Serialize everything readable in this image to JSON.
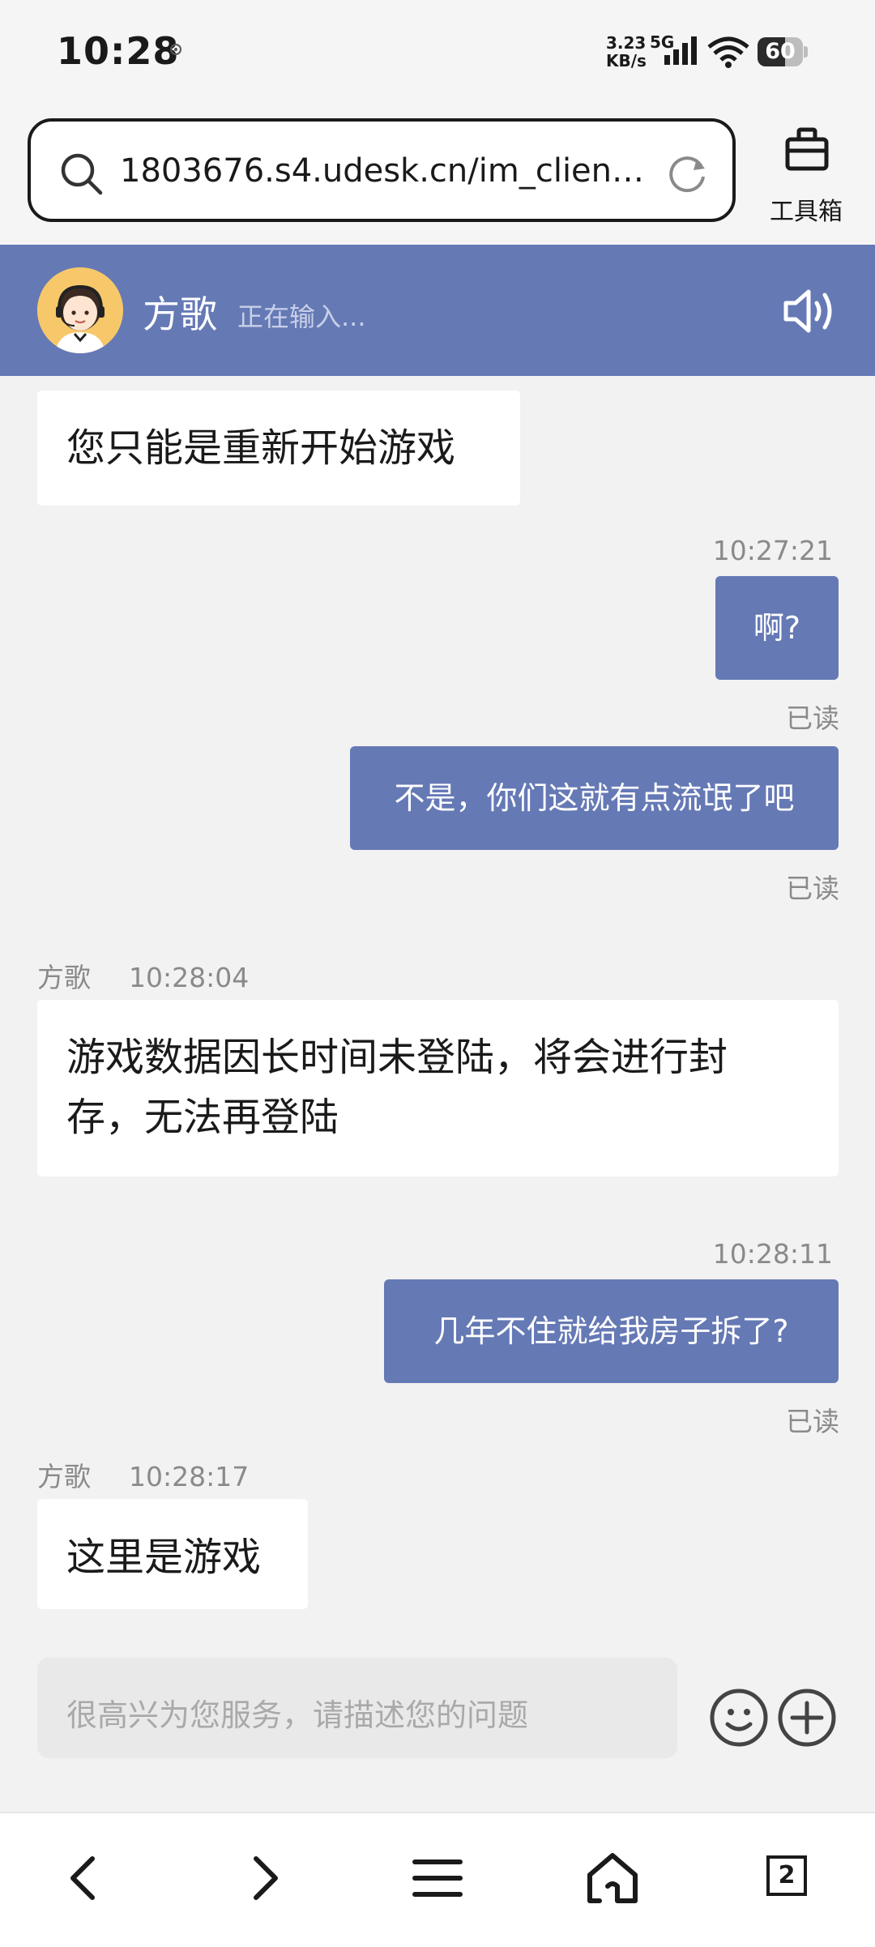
{
  "status_bar": {
    "time": "10:28",
    "net_speed_value": "3.23",
    "net_speed_unit": "KB/s",
    "network_type": "5G",
    "battery": "60",
    "battery_level": 0.6
  },
  "browser": {
    "url": "1803676.s4.udesk.cn/im_client/...",
    "toolbox_label": "工具箱"
  },
  "chat_header": {
    "agent_name": "方歌",
    "agent_status": "正在输入..."
  },
  "messages": [
    {
      "side": "left",
      "text": "您只能是重新开始游戏"
    },
    {
      "side": "right",
      "time": "10:27:21",
      "text": "啊?",
      "read": "已读"
    },
    {
      "side": "right",
      "text": "不是，你们这就有点流氓了吧",
      "read": "已读"
    },
    {
      "side": "left",
      "sender": "方歌",
      "time": "10:28:04",
      "text_line1": "游戏数据因长时间未登陆，将会进行封",
      "text_line2": "存，无法再登陆"
    },
    {
      "side": "right",
      "time": "10:28:11",
      "text": "几年不住就给我房子拆了?",
      "read": "已读"
    },
    {
      "side": "left",
      "sender": "方歌",
      "time": "10:28:17",
      "text": "这里是游戏"
    }
  ],
  "input": {
    "placeholder": "很高兴为您服务，请描述您的问题"
  },
  "nav": {
    "tab_count": "2"
  },
  "colors": {
    "header_bg": "#6579b5",
    "bubble_right": "#6579b5",
    "bubble_left": "#ffffff",
    "page_bg": "#f2f2f2"
  },
  "icons": [
    "search-icon",
    "reload-icon",
    "toolbox-icon",
    "speaker-icon",
    "emoji-icon",
    "plus-icon",
    "back-icon",
    "forward-icon",
    "menu-icon",
    "home-icon",
    "tabs-icon"
  ]
}
